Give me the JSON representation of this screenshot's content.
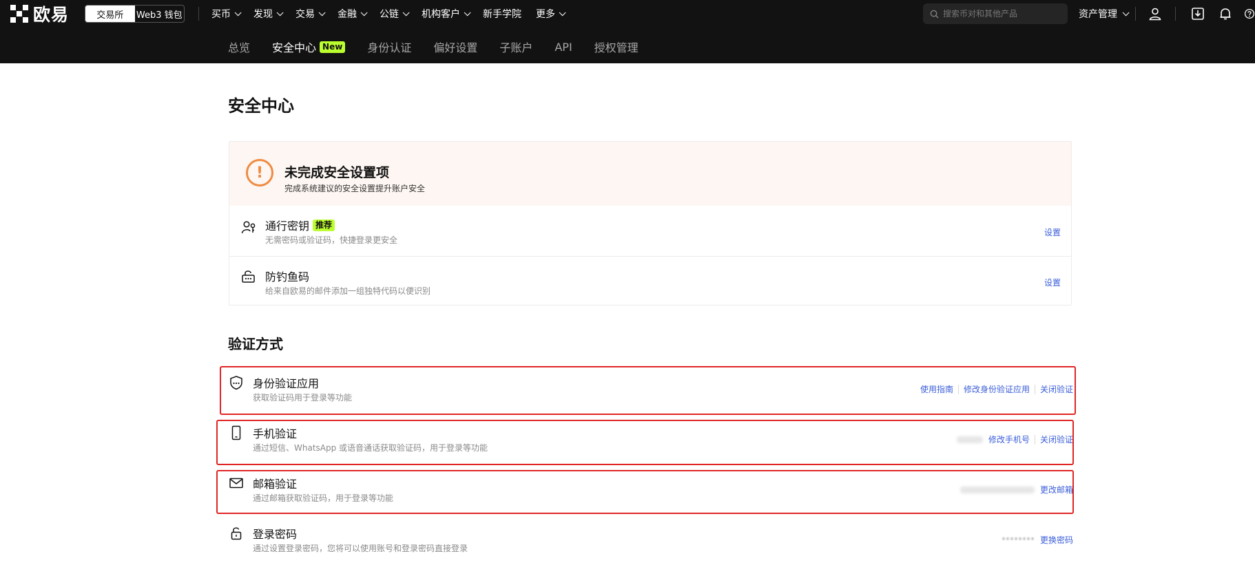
{
  "header": {
    "brand": "欧易",
    "switch": [
      "交易所",
      "Web3 钱包"
    ],
    "menu": [
      {
        "label": "买币",
        "dropdown": true
      },
      {
        "label": "发现",
        "dropdown": true
      },
      {
        "label": "交易",
        "dropdown": true
      },
      {
        "label": "金融",
        "dropdown": true
      },
      {
        "label": "公链",
        "dropdown": true
      },
      {
        "label": "机构客户",
        "dropdown": true
      },
      {
        "label": "新手学院",
        "dropdown": false
      },
      {
        "label": "更多",
        "dropdown": true
      }
    ],
    "search_placeholder": "搜索币对和其他产品",
    "asset_menu": "资产管理"
  },
  "subnav": {
    "items": [
      "总览",
      "安全中心",
      "身份认证",
      "偏好设置",
      "子账户",
      "API",
      "授权管理"
    ],
    "active": "安全中心",
    "new_badge": "New"
  },
  "page": {
    "title": "安全中心"
  },
  "incomplete": {
    "title": "未完成安全设置项",
    "subtitle": "完成系统建议的安全设置提升账户安全",
    "items": [
      {
        "title": "通行密钥",
        "badge": "推荐",
        "desc": "无需密码或验证码，快捷登录更安全",
        "action": "设置"
      },
      {
        "title": "防钓鱼码",
        "badge": "",
        "desc": "给来自欧易的邮件添加一组独特代码以便识别",
        "action": "设置"
      }
    ]
  },
  "verification": {
    "title": "验证方式",
    "items": [
      {
        "title": "身份验证应用",
        "desc": "获取验证码用于登录等功能",
        "value": "",
        "actions": [
          "使用指南",
          "修改身份验证应用",
          "关闭验证"
        ]
      },
      {
        "title": "手机验证",
        "desc": "通过短信、WhatsApp 或语音通话获取验证码，用于登录等功能",
        "value": "",
        "actions": [
          "修改手机号",
          "关闭验证"
        ]
      },
      {
        "title": "邮箱验证",
        "desc": "通过邮箱获取验证码，用于登录等功能",
        "value": "",
        "actions": [
          "更改邮箱"
        ]
      },
      {
        "title": "登录密码",
        "desc": "通过设置登录密码，您将可以使用账号和登录密码直接登录",
        "value": "********",
        "actions": [
          "更换密码"
        ]
      }
    ]
  },
  "colors": {
    "header_bg": "#121212",
    "accent_green": "#bcff2f",
    "link_blue": "#3a5ed9",
    "warning_orange": "#ef8b42",
    "highlight_red": "#e02424"
  }
}
